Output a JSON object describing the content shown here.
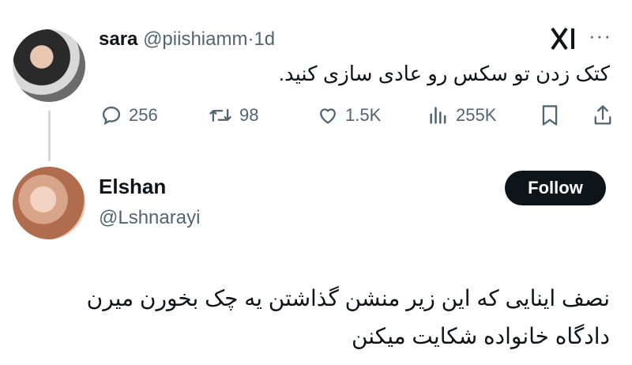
{
  "tweet": {
    "display_name": "sara",
    "handle": "@piishiamm",
    "separator": "·",
    "time": "1d",
    "text": "کتک زدن تو سکس رو عادی سازی کنید.",
    "more_label": "···",
    "replies": "256",
    "retweets": "98",
    "likes": "1.5K",
    "views": "255K"
  },
  "profile": {
    "display_name": "Elshan",
    "handle": "@Lshnarayi",
    "follow_label": "Follow"
  },
  "reply": {
    "line1": "نصف اینایی که این زیر منشن گذاشتن یه چک بخورن میرن",
    "line2": "دادگاه خانواده شکایت میکنن"
  },
  "icons": {
    "reply": "reply-icon",
    "retweet": "retweet-icon",
    "like": "heart-icon",
    "views": "views-icon",
    "bookmark": "bookmark-icon",
    "share": "share-icon",
    "logo": "x-logo-icon"
  },
  "colors": {
    "text": "#0f1419",
    "muted": "#536471",
    "follow_bg": "#0f1419",
    "thread_line": "#cfd9de"
  }
}
